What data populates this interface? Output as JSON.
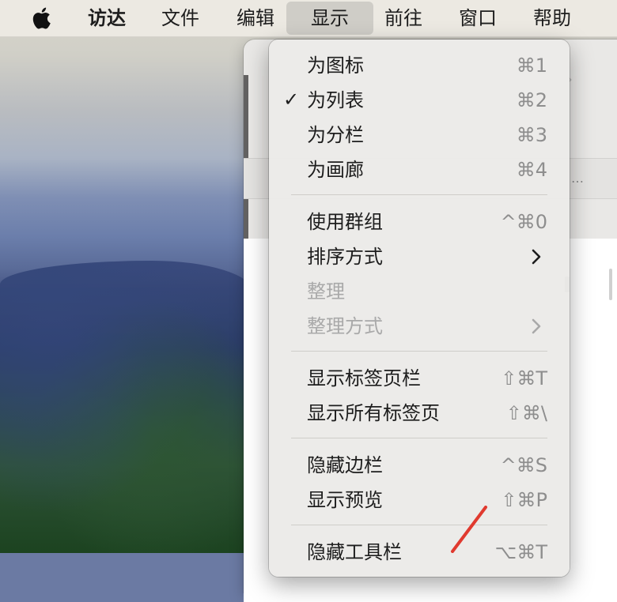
{
  "menubar": {
    "items": [
      {
        "label": "访达"
      },
      {
        "label": "文件"
      },
      {
        "label": "编辑"
      },
      {
        "label": "显示"
      },
      {
        "label": "前往"
      },
      {
        "label": "窗口"
      },
      {
        "label": "帮助"
      }
    ],
    "active_index": 3
  },
  "view_menu": {
    "items": [
      {
        "label": "为图标",
        "shortcut": "⌘1",
        "checked": false,
        "enabled": true
      },
      {
        "label": "为列表",
        "shortcut": "⌘2",
        "checked": true,
        "check_glyph": "✓",
        "enabled": true
      },
      {
        "label": "为分栏",
        "shortcut": "⌘3",
        "checked": false,
        "enabled": true
      },
      {
        "label": "为画廊",
        "shortcut": "⌘4",
        "checked": false,
        "enabled": true
      },
      {
        "label": "使用群组",
        "shortcut": "^⌘0",
        "enabled": true
      },
      {
        "label": "排序方式",
        "submenu": true,
        "enabled": true
      },
      {
        "label": "整理",
        "enabled": false
      },
      {
        "label": "整理方式",
        "submenu": true,
        "enabled": false
      },
      {
        "label": "显示标签页栏",
        "shortcut": "⇧⌘T",
        "enabled": true
      },
      {
        "label": "显示所有标签页",
        "shortcut": "⇧⌘\\",
        "enabled": true
      },
      {
        "label": "隐藏边栏",
        "shortcut": "^⌘S",
        "enabled": true
      },
      {
        "label": "显示预览",
        "shortcut": "⇧⌘P",
        "enabled": true
      },
      {
        "label": "隐藏工具栏",
        "shortcut": "⌥⌘T",
        "enabled": true
      }
    ]
  },
  "window_bg": {
    "chevron": "›",
    "ellipsis": "…"
  },
  "colors": {
    "menubar_bg": "#ece9e2",
    "menu_bg": "#ecebe9",
    "text": "#1d1d1d",
    "disabled_text": "#a9a9a9",
    "shortcut_text": "#8e8e8e",
    "annotation": "#e03a2f"
  },
  "icons": {
    "apple": "apple-logo-icon",
    "submenu": "chevron-right-icon",
    "annotation": "red-arrow-annotation"
  }
}
